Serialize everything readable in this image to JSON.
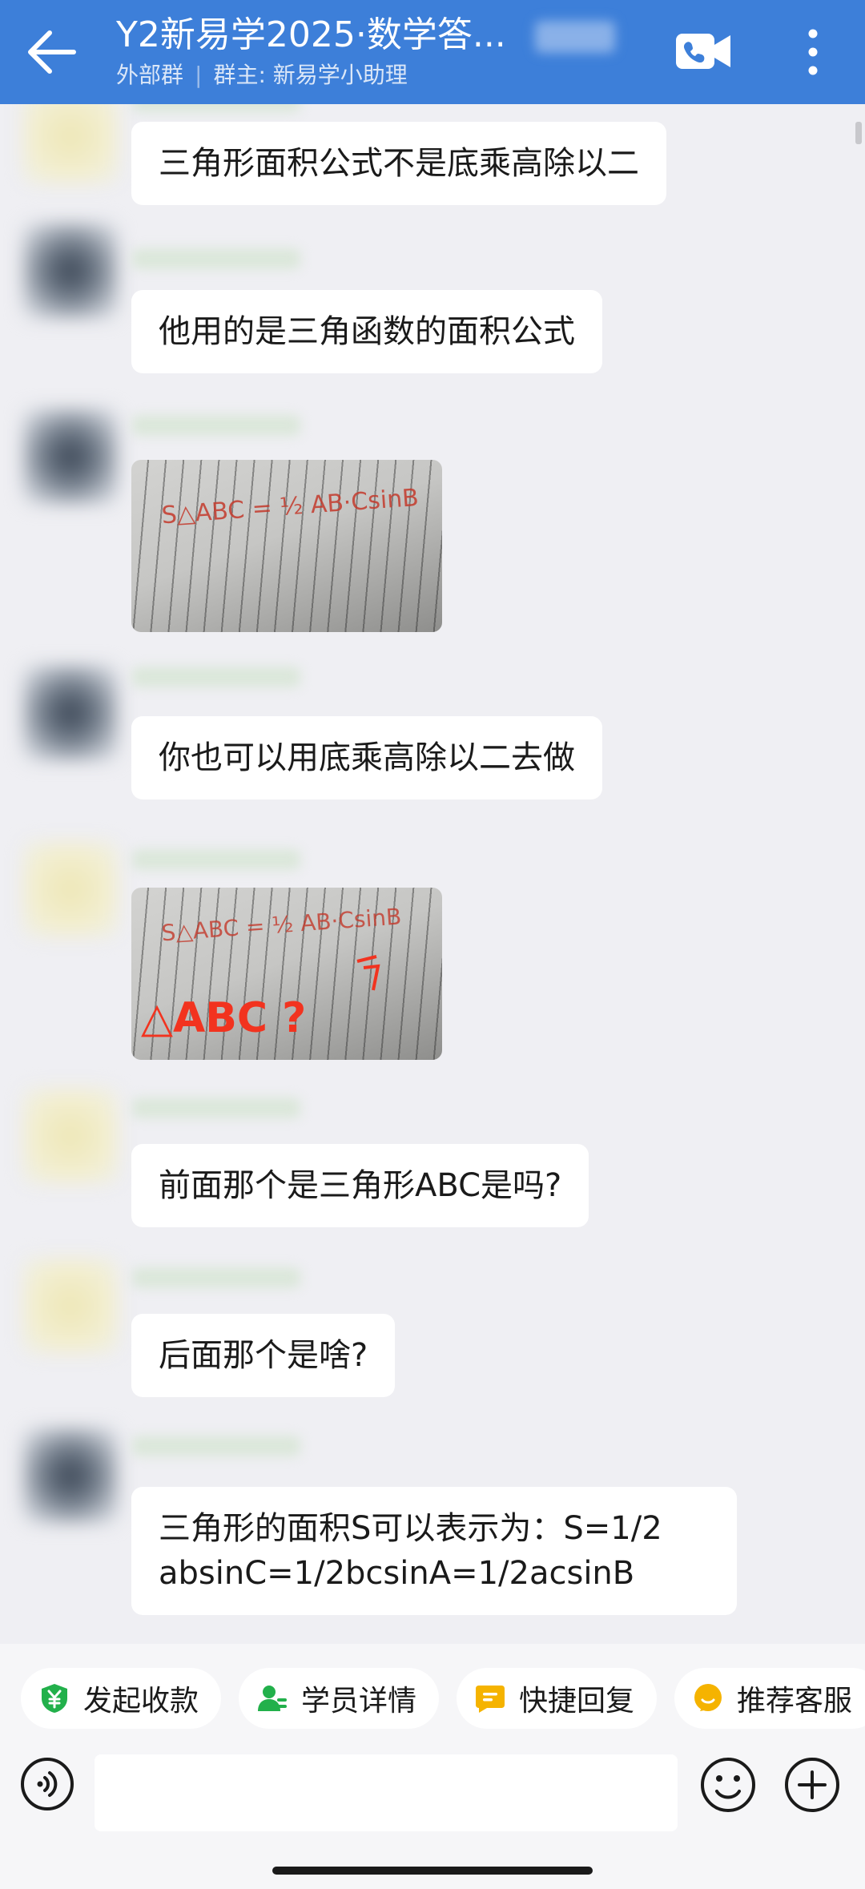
{
  "header": {
    "title": "Y2新易学2025·数学答...",
    "subtitle_left": "外部群",
    "subtitle_separator": "|",
    "subtitle_right": "群主: 新易学小助理",
    "icons": [
      "back-arrow-icon",
      "video-call-icon",
      "more-vertical-icon"
    ]
  },
  "messages": [
    {
      "type": "text",
      "text": "三角形面积公式不是底乘高除以二"
    },
    {
      "type": "text",
      "text": "他用的是三角函数的面积公式"
    },
    {
      "type": "image",
      "handwriting": "S△ABC = ½ AB·CsinB"
    },
    {
      "type": "text",
      "text": "你也可以用底乘高除以二去做"
    },
    {
      "type": "image",
      "handwriting": "S△ABC = ½ AB·CsinB",
      "annotation": "△ABC ?"
    },
    {
      "type": "text",
      "text": "前面那个是三角形ABC是吗?"
    },
    {
      "type": "text",
      "text": "后面那个是啥?"
    },
    {
      "type": "text",
      "line1": "三角形的面积S可以表示为：S=1/2",
      "line2": "absinC=1/2bcsinA=1/2acsinB"
    }
  ],
  "quick_actions": [
    {
      "label": "发起收款",
      "icon": "yen-shield-icon",
      "color": "#22b04b"
    },
    {
      "label": "学员详情",
      "icon": "user-card-icon",
      "color": "#22b04b"
    },
    {
      "label": "快捷回复",
      "icon": "quick-reply-icon",
      "color": "#f5b300"
    },
    {
      "label": "推荐客服",
      "icon": "service-chat-icon",
      "color": "#f5b300"
    }
  ],
  "input_bar": {
    "placeholder": "",
    "icons": [
      "voice-icon",
      "emoji-icon",
      "plus-icon"
    ]
  },
  "colors": {
    "header_bg": "#3d7fd9",
    "chat_bg": "#efeff3",
    "accent_green": "#22b04b",
    "accent_yellow": "#f5b300"
  }
}
